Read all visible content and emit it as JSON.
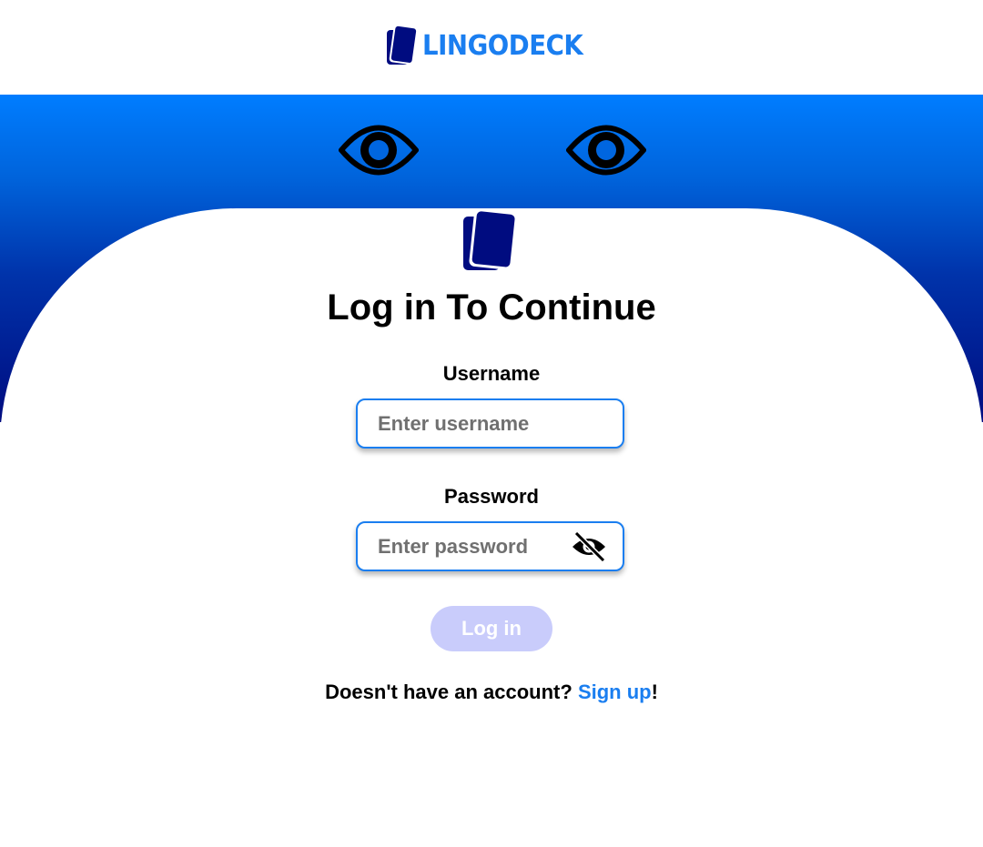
{
  "header": {
    "brand_name": "LINGODECK",
    "logo_icon": "cards-logo-icon"
  },
  "decor": {
    "left_eye_icon": "eye-icon",
    "right_eye_icon": "eye-icon"
  },
  "form": {
    "title": "Log in To Continue",
    "username_label": "Username",
    "username_placeholder": "Enter username",
    "username_value": "",
    "password_label": "Password",
    "password_placeholder": "Enter password",
    "password_value": "",
    "password_toggle_icon": "eye-slash-icon",
    "login_label": "Log in",
    "login_enabled": false
  },
  "signup": {
    "prompt": "Doesn't have an account? ",
    "link_label": "Sign up",
    "suffix": "!"
  },
  "colors": {
    "accent": "#1a7ef0",
    "logo_navy": "#000c80",
    "gradient_top": "#007dff",
    "gradient_bottom": "#000c80",
    "login_disabled": "#c9ccfb"
  }
}
